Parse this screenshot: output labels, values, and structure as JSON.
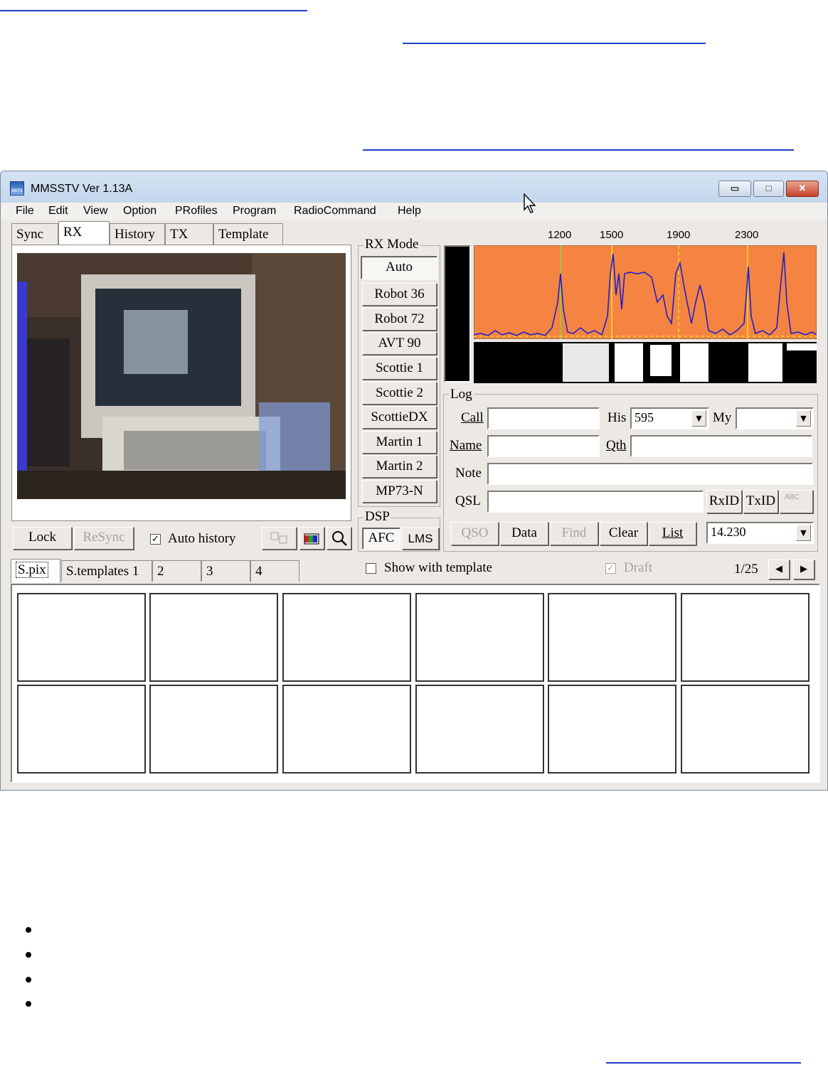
{
  "window": {
    "title": "MMSSTV Ver 1.13A",
    "app_icon_text": "SSTV",
    "min_glyph": "▭",
    "max_glyph": "□",
    "close_glyph": "✕"
  },
  "menu": [
    "File",
    "Edit",
    "View",
    "Option",
    "PRofiles",
    "Program",
    "RadioCommand",
    "Help"
  ],
  "tabs": [
    "Sync",
    "RX",
    "History",
    "TX",
    "Template"
  ],
  "rx_controls": {
    "lock": "Lock",
    "resync": "ReSync",
    "auto_history": "Auto history",
    "auto_history_checked": "✓"
  },
  "rx_mode": {
    "label": "RX Mode",
    "modes": [
      "Auto",
      "Robot 36",
      "Robot 72",
      "AVT 90",
      "Scottie 1",
      "Scottie 2",
      "ScottieDX",
      "Martin 1",
      "Martin 2",
      "MP73-N"
    ]
  },
  "dsp": {
    "label": "DSP",
    "afc": "AFC",
    "lms": "LMS"
  },
  "spectrum": {
    "markers": [
      "1200",
      "1500",
      "1900",
      "2300"
    ],
    "background": "#f58442",
    "trace_color": "#2020c8"
  },
  "log": {
    "label": "Log",
    "call_label": "Call",
    "his_label": "His",
    "his_value": "595",
    "my_label": "My",
    "name_label": "Name",
    "qth_label": "Qth",
    "note_label": "Note",
    "qsl_label": "QSL",
    "rxid": "RxID",
    "txid": "TxID",
    "abc": "ABC"
  },
  "log_buttons": {
    "qso": "QSO",
    "data": "Data",
    "find": "Find",
    "clear": "Clear",
    "list": "List",
    "freq": "14.230"
  },
  "bottom_tabs": [
    "S.pix",
    "S.templates 1",
    "2",
    "3",
    "4"
  ],
  "template_bar": {
    "show_with_template": "Show with template",
    "draft": "Draft",
    "draft_check": "✓",
    "page": "1/25",
    "prev": "◀",
    "next": "▶"
  }
}
